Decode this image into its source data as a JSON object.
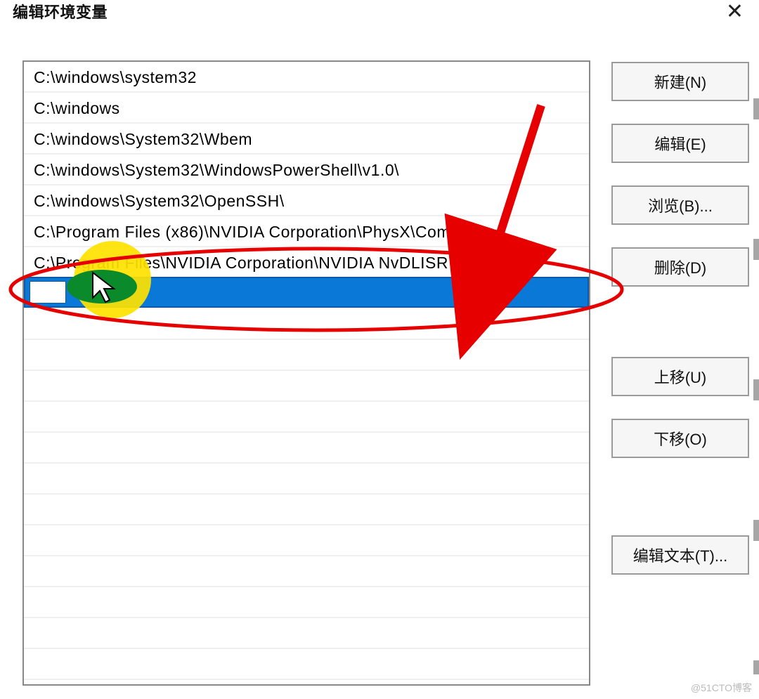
{
  "window": {
    "title": "编辑环境变量"
  },
  "list": {
    "items": [
      "C:\\windows\\system32",
      "C:\\windows",
      "C:\\windows\\System32\\Wbem",
      "C:\\windows\\System32\\WindowsPowerShell\\v1.0\\",
      "C:\\windows\\System32\\OpenSSH\\",
      "C:\\Program Files (x86)\\NVIDIA Corporation\\PhysX\\Common",
      "C:\\Program Files\\NVIDIA Corporation\\NVIDIA NvDLISR"
    ],
    "new_entry_value": ""
  },
  "buttons": {
    "new": "新建(N)",
    "edit": "编辑(E)",
    "browse": "浏览(B)...",
    "delete": "删除(D)",
    "move_up": "上移(U)",
    "move_down": "下移(O)",
    "edit_text": "编辑文本(T)..."
  },
  "annotations": {
    "arrow_color": "#e60000",
    "ellipse_color": "#e60000",
    "highlight_color_outer": "#ffe200",
    "highlight_color_inner": "#0a8a2a",
    "cursor_color": "#ffffff"
  },
  "watermark": "@51CTO博客"
}
